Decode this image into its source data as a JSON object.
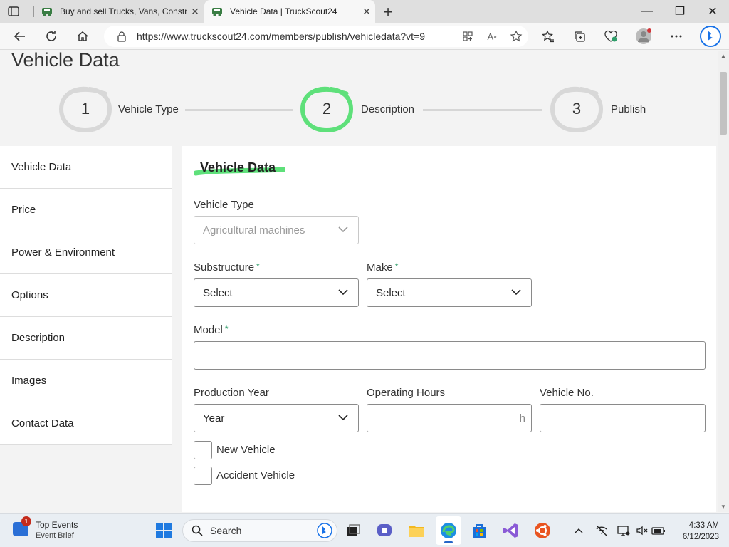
{
  "browser": {
    "tabs": [
      {
        "title": "Buy and sell Trucks, Vans, Constr",
        "icon": "truckscout-favicon",
        "active": false
      },
      {
        "title": "Vehicle Data | TruckScout24",
        "icon": "truckscout-favicon",
        "active": true
      }
    ],
    "url": "https://www.truckscout24.com/members/publish/vehicledata?vt=9",
    "window_controls": {
      "minimize": "—",
      "maximize": "❐",
      "close": "✕"
    }
  },
  "page": {
    "title": "Vehicle Data",
    "steps": [
      {
        "number": "1",
        "label": "Vehicle Type",
        "state": "done"
      },
      {
        "number": "2",
        "label": "Description",
        "state": "active"
      },
      {
        "number": "3",
        "label": "Publish",
        "state": "pending"
      }
    ],
    "sidebar": [
      "Vehicle Data",
      "Price",
      "Power & Environment",
      "Options",
      "Description",
      "Images",
      "Contact Data"
    ],
    "form": {
      "section_title": "Vehicle Data",
      "vehicle_type": {
        "label": "Vehicle Type",
        "value": "Agricultural machines"
      },
      "substructure": {
        "label": "Substructure",
        "required_mark": "*",
        "value": "Select"
      },
      "make": {
        "label": "Make",
        "required_mark": "*",
        "value": "Select"
      },
      "model": {
        "label": "Model",
        "required_mark": "*",
        "value": ""
      },
      "production_year": {
        "label": "Production Year",
        "value": "Year"
      },
      "operating_hours": {
        "label": "Operating Hours",
        "unit": "h",
        "value": ""
      },
      "vehicle_no": {
        "label": "Vehicle No.",
        "value": ""
      },
      "new_vehicle": {
        "label": "New Vehicle",
        "checked": false
      },
      "accident_vehicle": {
        "label": "Accident Vehicle",
        "checked": false
      }
    }
  },
  "colors": {
    "accent_green": "#5ee07a",
    "required_green": "#2f9d6a",
    "step_grey": "#d6d6d6"
  },
  "taskbar": {
    "news_title": "Top Events",
    "news_subtitle": "Event Brief",
    "news_badge": "1",
    "search_placeholder": "Search",
    "time": "4:33 AM",
    "date": "6/12/2023"
  }
}
